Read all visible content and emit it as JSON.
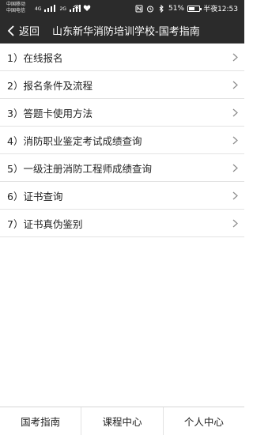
{
  "status_bar": {
    "carrier_1": "中国移动",
    "carrier_2": "中国电信",
    "net_1": "4G",
    "net_2": "2G",
    "battery_percent": "51%",
    "battery_level": 0.51,
    "time": "半夜12:53",
    "icons": [
      "signal-icon",
      "wifi-icon",
      "heart-icon",
      "nfc-icon",
      "alarm-icon",
      "bluetooth-icon",
      "battery-icon"
    ]
  },
  "header": {
    "back_label": "返回",
    "title": "山东新华消防培训学校-国考指南",
    "bg_color": "#2b2b2b"
  },
  "menu": {
    "items": [
      {
        "label": "1）在线报名"
      },
      {
        "label": "2）报名条件及流程"
      },
      {
        "label": "3）答题卡使用方法"
      },
      {
        "label": "4）消防职业鉴定考试成绩查询"
      },
      {
        "label": "5）一级注册消防工程师成绩查询"
      },
      {
        "label": "6）证书查询"
      },
      {
        "label": "7）证书真伪鉴别"
      }
    ]
  },
  "tabbar": {
    "tabs": [
      {
        "label": "国考指南"
      },
      {
        "label": "课程中心"
      },
      {
        "label": "个人中心"
      }
    ]
  }
}
